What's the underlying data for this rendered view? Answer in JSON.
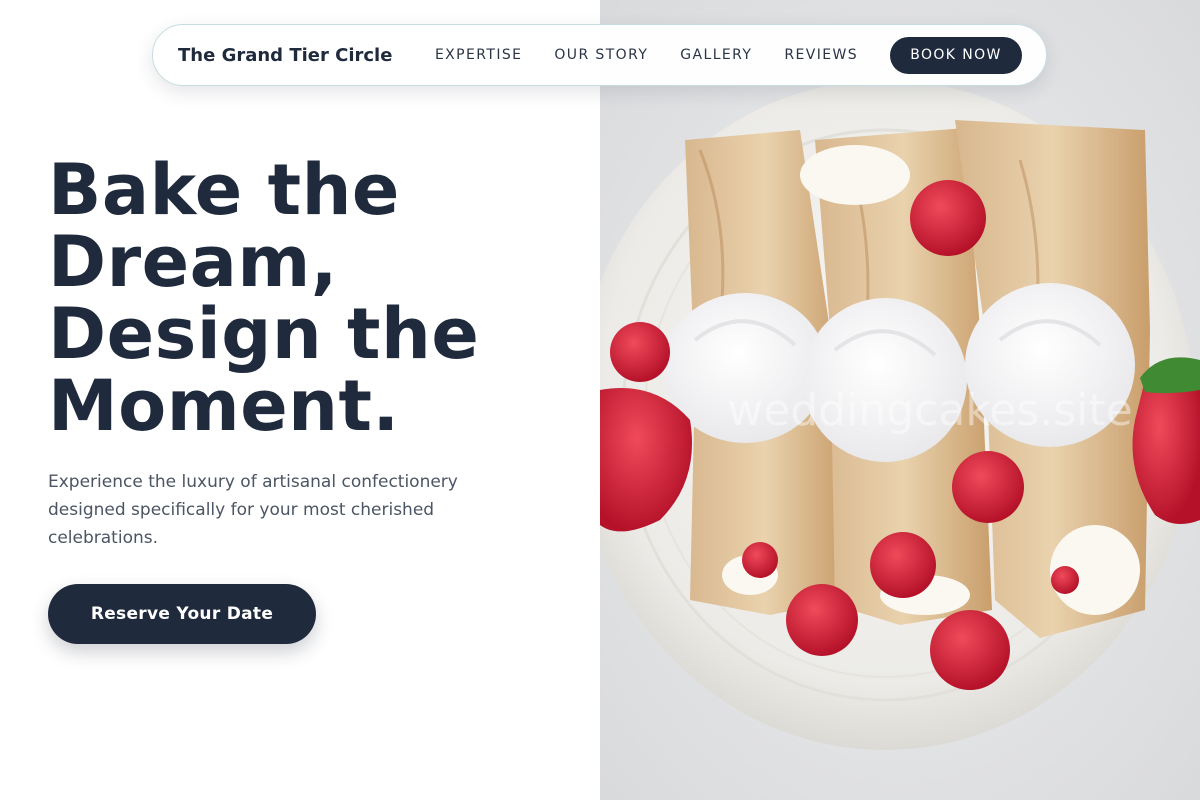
{
  "brand": {
    "name": "The Grand Tier Circle"
  },
  "nav": {
    "links": [
      "EXPERTISE",
      "OUR STORY",
      "GALLERY",
      "REVIEWS"
    ],
    "cta_label": "BOOK NOW"
  },
  "hero": {
    "title_lines": [
      "Bake the",
      "Dream,",
      "Design the",
      "Moment."
    ],
    "subtitle": "Experience the luxury of artisanal confectionery designed specifically for your most cherished celebrations.",
    "cta_label": "Reserve Your Date",
    "image_watermark": "weddingcakes.site"
  },
  "colors": {
    "navy": "#1f2a3d",
    "body_text": "#4b5563",
    "nav_border": "#c7dde2"
  }
}
